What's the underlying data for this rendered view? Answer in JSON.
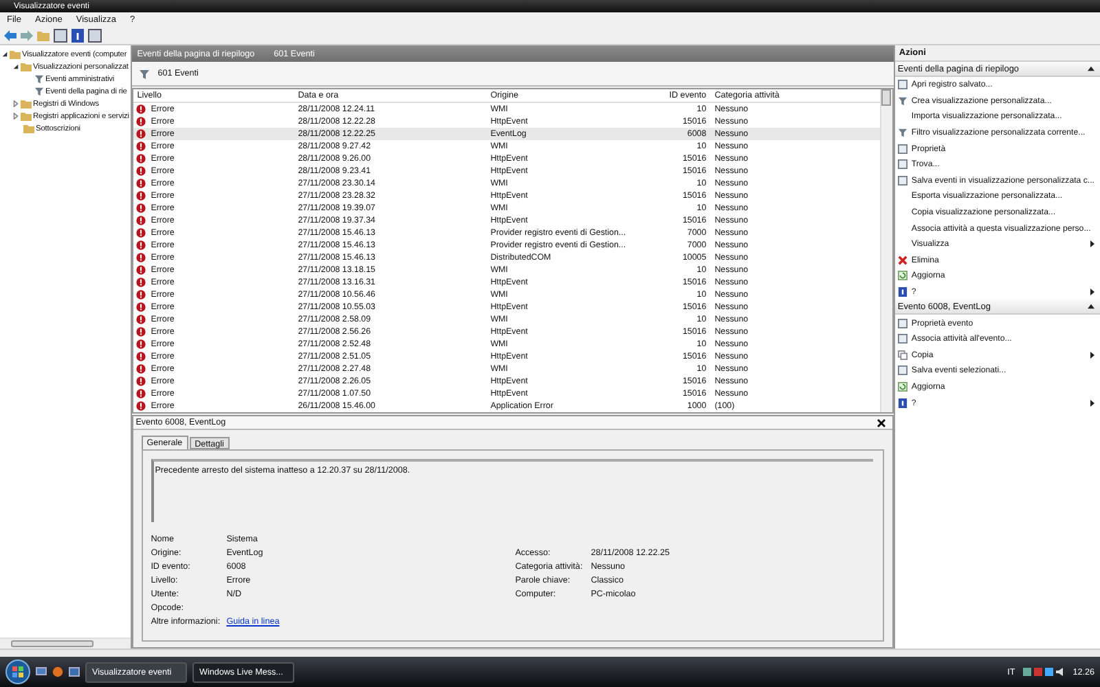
{
  "window": {
    "title": "Visualizzatore eventi"
  },
  "menu": [
    "File",
    "Azione",
    "Visualizza",
    "?"
  ],
  "tree": [
    {
      "label": "Visualizzatore eventi (computer",
      "expanded": true,
      "children": [
        {
          "label": "Visualizzazioni personalizzat",
          "expanded": true,
          "children": [
            {
              "label": "Eventi amministrativi"
            },
            {
              "label": "Eventi della pagina di rie"
            }
          ]
        },
        {
          "label": "Registri di Windows",
          "expanded": false
        },
        {
          "label": "Registri applicazioni e servizi",
          "expanded": false
        },
        {
          "label": "Sottoscrizioni"
        }
      ]
    }
  ],
  "center_header": {
    "title": "Eventi della pagina di riepilogo",
    "count": "601 Eventi"
  },
  "filter_label": "601 Eventi",
  "table": {
    "columns": [
      "Livello",
      "Data e ora",
      "Origine",
      "ID evento",
      "Categoria attività"
    ],
    "rows": [
      {
        "level": "Errore",
        "date": "28/11/2008 12.24.11",
        "source": "WMI",
        "id": "10",
        "category": "Nessuno",
        "selected": false
      },
      {
        "level": "Errore",
        "date": "28/11/2008 12.22.28",
        "source": "HttpEvent",
        "id": "15016",
        "category": "Nessuno",
        "selected": false
      },
      {
        "level": "Errore",
        "date": "28/11/2008 12.22.25",
        "source": "EventLog",
        "id": "6008",
        "category": "Nessuno",
        "selected": true
      },
      {
        "level": "Errore",
        "date": "28/11/2008 9.27.42",
        "source": "WMI",
        "id": "10",
        "category": "Nessuno",
        "selected": false
      },
      {
        "level": "Errore",
        "date": "28/11/2008 9.26.00",
        "source": "HttpEvent",
        "id": "15016",
        "category": "Nessuno",
        "selected": false
      },
      {
        "level": "Errore",
        "date": "28/11/2008 9.23.41",
        "source": "HttpEvent",
        "id": "15016",
        "category": "Nessuno",
        "selected": false
      },
      {
        "level": "Errore",
        "date": "27/11/2008 23.30.14",
        "source": "WMI",
        "id": "10",
        "category": "Nessuno",
        "selected": false
      },
      {
        "level": "Errore",
        "date": "27/11/2008 23.28.32",
        "source": "HttpEvent",
        "id": "15016",
        "category": "Nessuno",
        "selected": false
      },
      {
        "level": "Errore",
        "date": "27/11/2008 19.39.07",
        "source": "WMI",
        "id": "10",
        "category": "Nessuno",
        "selected": false
      },
      {
        "level": "Errore",
        "date": "27/11/2008 19.37.34",
        "source": "HttpEvent",
        "id": "15016",
        "category": "Nessuno",
        "selected": false
      },
      {
        "level": "Errore",
        "date": "27/11/2008 15.46.13",
        "source": "Provider registro eventi di Gestion...",
        "id": "7000",
        "category": "Nessuno",
        "selected": false
      },
      {
        "level": "Errore",
        "date": "27/11/2008 15.46.13",
        "source": "Provider registro eventi di Gestion...",
        "id": "7000",
        "category": "Nessuno",
        "selected": false
      },
      {
        "level": "Errore",
        "date": "27/11/2008 15.46.13",
        "source": "DistributedCOM",
        "id": "10005",
        "category": "Nessuno",
        "selected": false
      },
      {
        "level": "Errore",
        "date": "27/11/2008 13.18.15",
        "source": "WMI",
        "id": "10",
        "category": "Nessuno",
        "selected": false
      },
      {
        "level": "Errore",
        "date": "27/11/2008 13.16.31",
        "source": "HttpEvent",
        "id": "15016",
        "category": "Nessuno",
        "selected": false
      },
      {
        "level": "Errore",
        "date": "27/11/2008 10.56.46",
        "source": "WMI",
        "id": "10",
        "category": "Nessuno",
        "selected": false
      },
      {
        "level": "Errore",
        "date": "27/11/2008 10.55.03",
        "source": "HttpEvent",
        "id": "15016",
        "category": "Nessuno",
        "selected": false
      },
      {
        "level": "Errore",
        "date": "27/11/2008 2.58.09",
        "source": "WMI",
        "id": "10",
        "category": "Nessuno",
        "selected": false
      },
      {
        "level": "Errore",
        "date": "27/11/2008 2.56.26",
        "source": "HttpEvent",
        "id": "15016",
        "category": "Nessuno",
        "selected": false
      },
      {
        "level": "Errore",
        "date": "27/11/2008 2.52.48",
        "source": "WMI",
        "id": "10",
        "category": "Nessuno",
        "selected": false
      },
      {
        "level": "Errore",
        "date": "27/11/2008 2.51.05",
        "source": "HttpEvent",
        "id": "15016",
        "category": "Nessuno",
        "selected": false
      },
      {
        "level": "Errore",
        "date": "27/11/2008 2.27.48",
        "source": "WMI",
        "id": "10",
        "category": "Nessuno",
        "selected": false
      },
      {
        "level": "Errore",
        "date": "27/11/2008 2.26.05",
        "source": "HttpEvent",
        "id": "15016",
        "category": "Nessuno",
        "selected": false
      },
      {
        "level": "Errore",
        "date": "27/11/2008 1.07.50",
        "source": "HttpEvent",
        "id": "15016",
        "category": "Nessuno",
        "selected": false
      },
      {
        "level": "Errore",
        "date": "26/11/2008 15.46.00",
        "source": "Application Error",
        "id": "1000",
        "category": "(100)",
        "selected": false
      }
    ]
  },
  "detail": {
    "title": "Evento 6008, EventLog",
    "tabs": [
      {
        "label": "Generale",
        "selected": true
      },
      {
        "label": "Dettagli",
        "selected": false
      }
    ],
    "message": "Precedente arresto del sistema inatteso a 12.20.37 su 28/11/2008.",
    "left_fields": [
      {
        "label": "Nome",
        "value": "Sistema"
      },
      {
        "label": "Origine:",
        "value": "EventLog"
      },
      {
        "label": "ID evento:",
        "value": "6008"
      },
      {
        "label": "Livello:",
        "value": "Errore"
      },
      {
        "label": "Utente:",
        "value": "N/D"
      },
      {
        "label": "Opcode:"
      },
      {
        "label": "Altre informazioni:",
        "link": "Guida in linea"
      }
    ],
    "right_fields": [
      {
        "label": "Accesso:",
        "value": "28/11/2008 12.22.25"
      },
      {
        "label": "Categoria attività:",
        "value": "Nessuno"
      },
      {
        "label": "Parole chiave:",
        "value": "Classico"
      },
      {
        "label": "Computer:",
        "value": "PC-micolao"
      }
    ]
  },
  "actions": {
    "title": "Azioni",
    "sections": [
      {
        "title": "Eventi della pagina di riepilogo",
        "expanded": true,
        "items": [
          {
            "label": "Apri registro salvato...",
            "kind": "icon"
          },
          {
            "label": "Crea visualizzazione personalizzata...",
            "kind": "filter"
          },
          {
            "label": "Importa visualizzazione personalizzata...",
            "kind": "plain"
          },
          {
            "label": "Filtro visualizzazione personalizzata corrente...",
            "kind": "filter"
          },
          {
            "label": "Proprietà",
            "kind": "icon"
          },
          {
            "label": "Trova...",
            "kind": "icon"
          },
          {
            "label": "Salva eventi in visualizzazione personalizzata c...",
            "kind": "icon"
          },
          {
            "label": "Esporta visualizzazione personalizzata...",
            "kind": "plain"
          },
          {
            "label": "Copia visualizzazione personalizzata...",
            "kind": "plain"
          },
          {
            "label": "Associa attività a questa visualizzazione perso...",
            "kind": "plain"
          },
          {
            "label": "Visualizza",
            "kind": "submenu"
          },
          {
            "label": "Elimina",
            "kind": "delete"
          },
          {
            "label": "Aggiorna",
            "kind": "refresh"
          },
          {
            "label": "?",
            "kind": "help"
          }
        ]
      },
      {
        "title": "Evento 6008, EventLog",
        "expanded": true,
        "items": [
          {
            "label": "Proprietà evento",
            "kind": "icon"
          },
          {
            "label": "Associa attività all'evento...",
            "kind": "icon"
          },
          {
            "label": "Copia",
            "kind": "copy"
          },
          {
            "label": "Salva eventi selezionati...",
            "kind": "icon"
          },
          {
            "label": "Aggiorna",
            "kind": "refresh"
          },
          {
            "label": "?",
            "kind": "help"
          }
        ]
      }
    ]
  },
  "taskbar": {
    "buttons": [
      {
        "label": "Visualizzatore eventi",
        "selected": true
      },
      {
        "label": "Windows Live Mess...",
        "selected": false
      }
    ],
    "language": "IT",
    "clock": "12.26"
  }
}
